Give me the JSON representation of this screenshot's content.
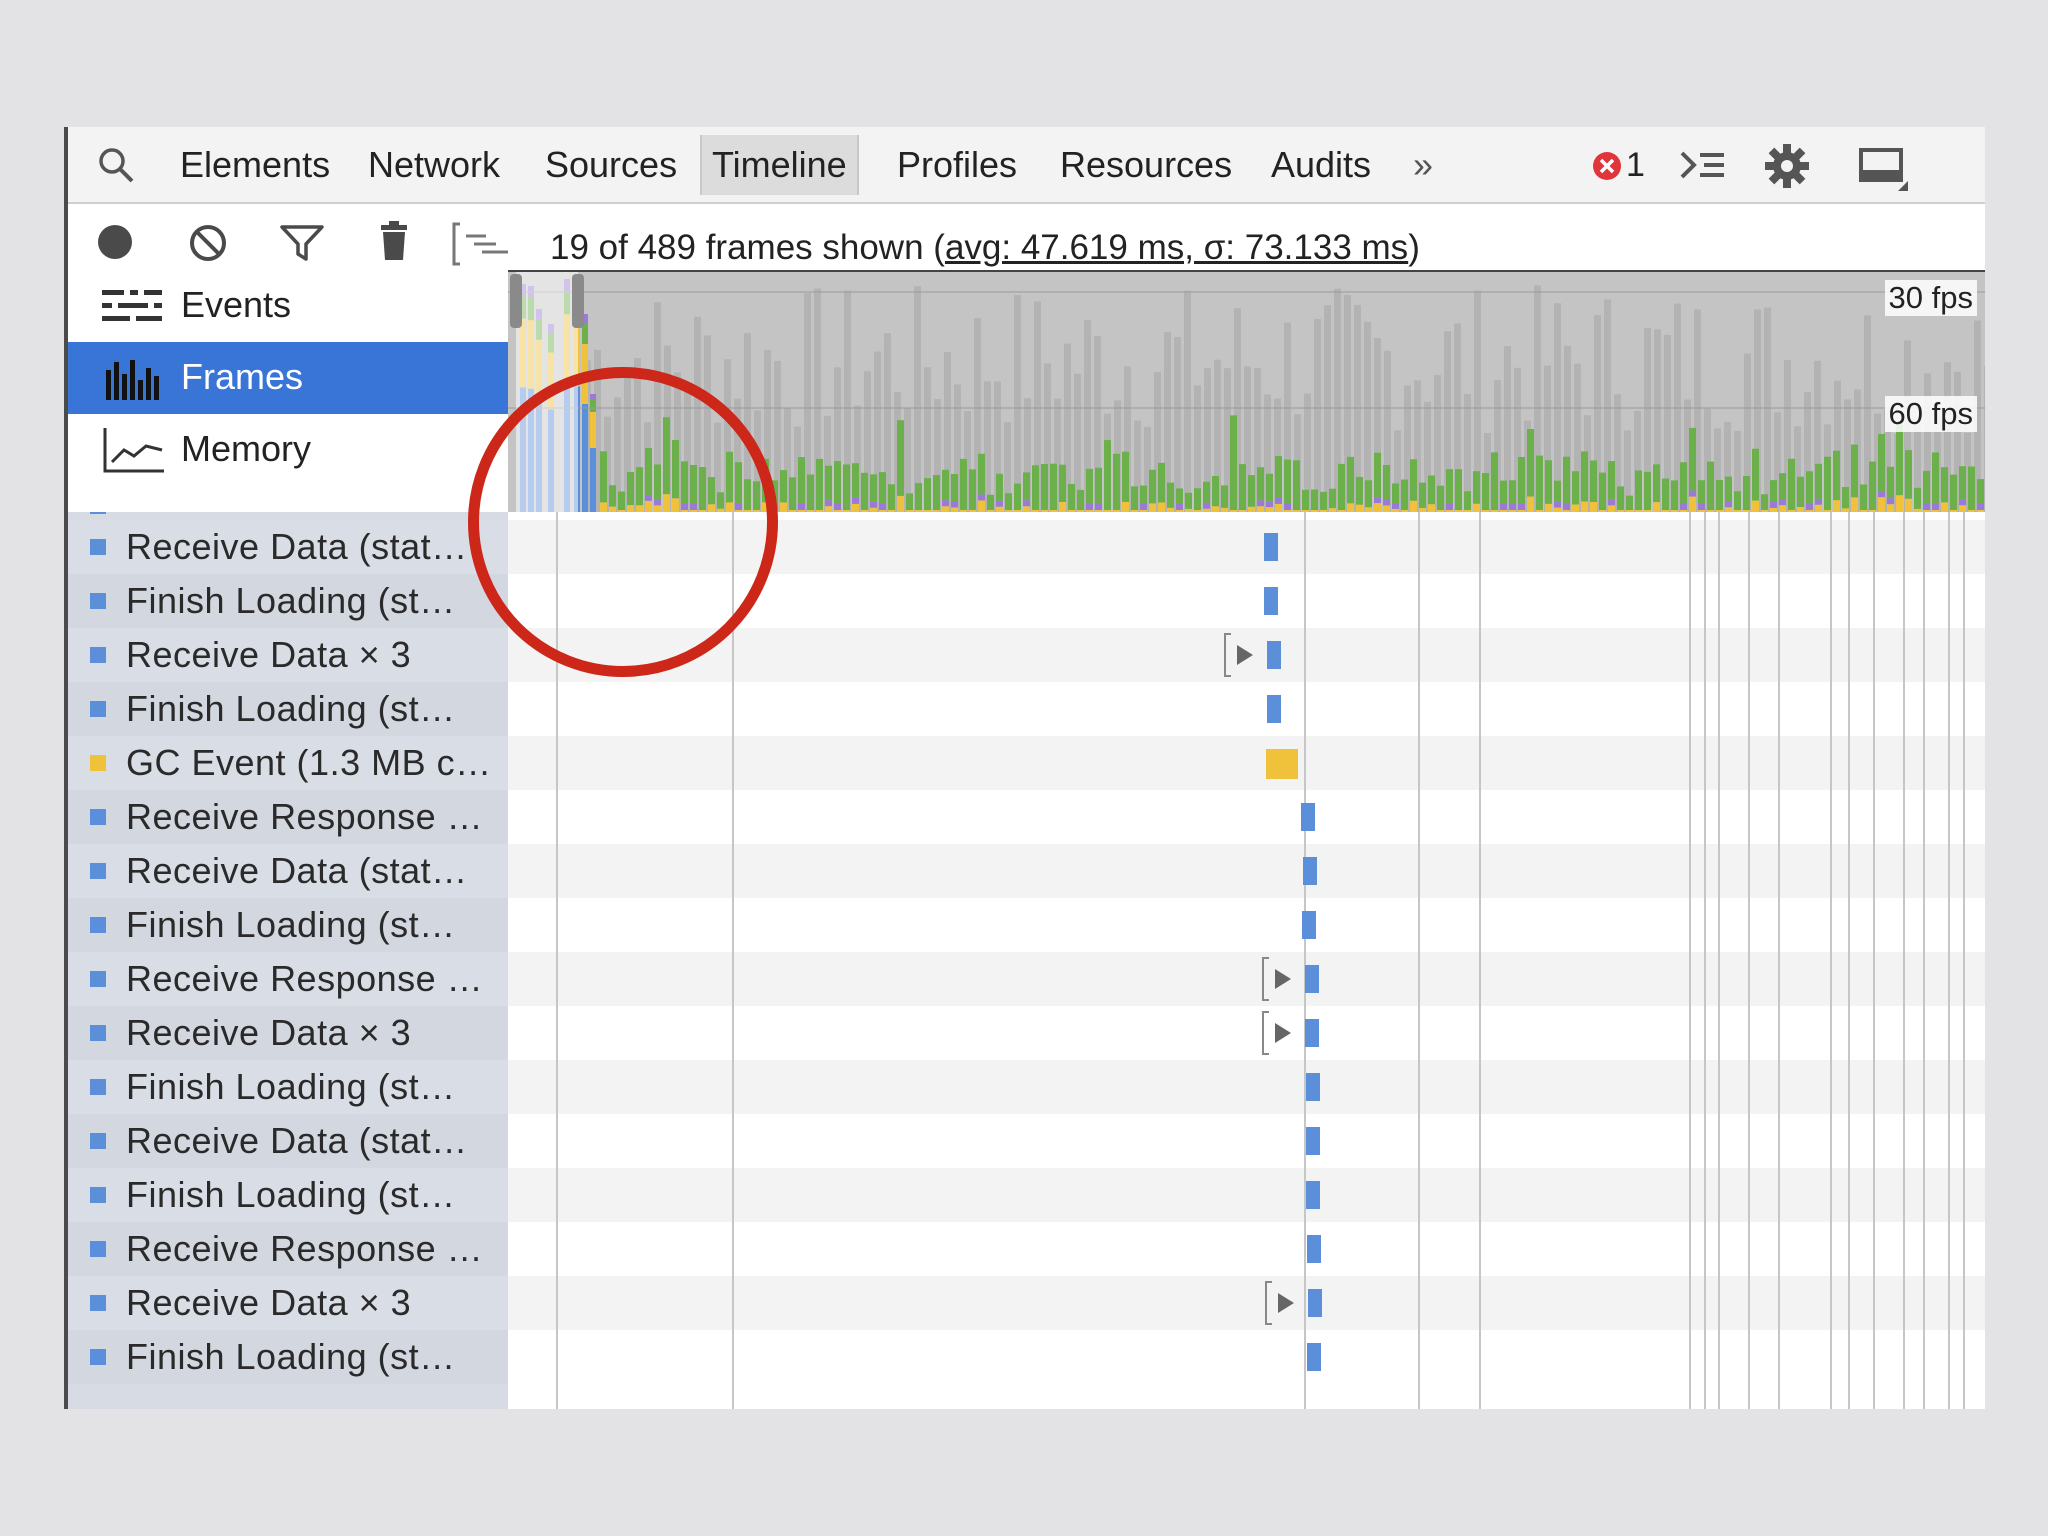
{
  "tabs": [
    {
      "label": "Elements"
    },
    {
      "label": "Network"
    },
    {
      "label": "Sources"
    },
    {
      "label": "Timeline",
      "selected": true
    },
    {
      "label": "Profiles"
    },
    {
      "label": "Resources"
    },
    {
      "label": "Audits"
    }
  ],
  "more_tabs_label": "»",
  "error_count": "1",
  "icons": {
    "search": "search-icon",
    "error": "error-icon",
    "console_drawer": "console-drawer-icon",
    "settings": "gear-icon",
    "dock": "dock-icon",
    "close": "close-icon",
    "record": "record-icon",
    "clear": "clear-icon",
    "filter": "filter-icon",
    "garbage": "trash-icon",
    "flame": "flame-chart-icon"
  },
  "toolbar": {
    "frames_summary_prefix": "19 of 489 frames shown (",
    "frames_summary_stats": "avg: 47.619 ms, σ: 73.133 ms",
    "frames_summary_suffix": ")"
  },
  "views": [
    {
      "label": "Events",
      "icon": "events-icon"
    },
    {
      "label": "Frames",
      "icon": "frames-icon",
      "selected": true
    },
    {
      "label": "Memory",
      "icon": "memory-icon"
    }
  ],
  "overview": {
    "fps_30_label": "30 fps",
    "fps_60_label": "60 fps"
  },
  "colors": {
    "loading": "#5b8fd9",
    "scripting": "#f0c23b",
    "rendering": "#9a7ad6",
    "painting": "#6bb04a",
    "selected": "#3875d7",
    "annotation": "#cc2718"
  },
  "records": [
    {
      "label": "Receive Data (stat…",
      "color": "#5b8fd9"
    },
    {
      "label": "Finish Loading (st…",
      "color": "#5b8fd9"
    },
    {
      "label": "Receive Data × 3",
      "color": "#5b8fd9",
      "expandable": true
    },
    {
      "label": "Finish Loading (st…",
      "color": "#5b8fd9"
    },
    {
      "label": "GC Event (1.3 MB c…",
      "color": "#f0c23b"
    },
    {
      "label": "Receive Response …",
      "color": "#5b8fd9"
    },
    {
      "label": "Receive Data (stat…",
      "color": "#5b8fd9"
    },
    {
      "label": "Finish Loading (st…",
      "color": "#5b8fd9"
    },
    {
      "label": "Receive Response …",
      "color": "#5b8fd9",
      "expandable": true
    },
    {
      "label": "Receive Data × 3",
      "color": "#5b8fd9",
      "expandable": true
    },
    {
      "label": "Finish Loading (st…",
      "color": "#5b8fd9"
    },
    {
      "label": "Receive Data (stat…",
      "color": "#5b8fd9"
    },
    {
      "label": "Finish Loading (st…",
      "color": "#5b8fd9"
    },
    {
      "label": "Receive Response …",
      "color": "#5b8fd9"
    },
    {
      "label": "Receive Data × 3",
      "color": "#5b8fd9",
      "expandable": true
    },
    {
      "label": "Finish Loading (st…",
      "color": "#5b8fd9"
    }
  ]
}
